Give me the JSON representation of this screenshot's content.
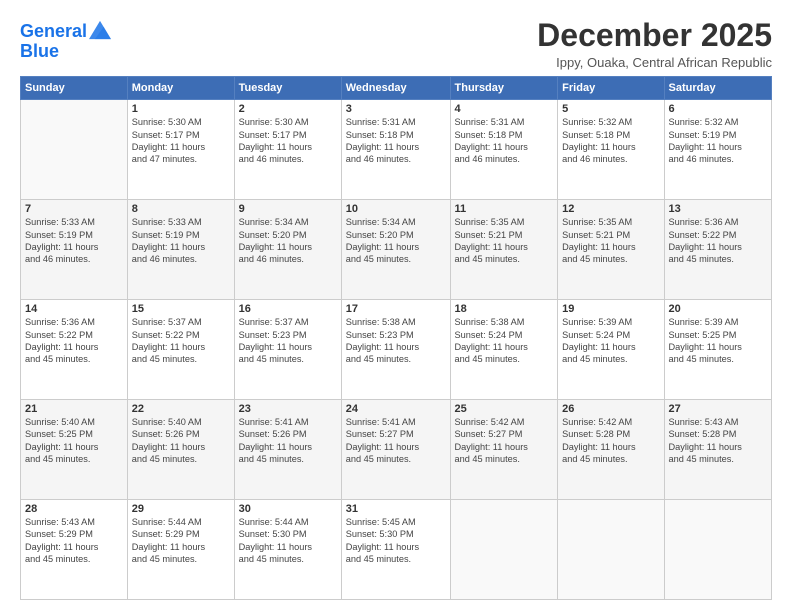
{
  "logo": {
    "line1": "General",
    "line2": "Blue"
  },
  "title": "December 2025",
  "subtitle": "Ippy, Ouaka, Central African Republic",
  "days_of_week": [
    "Sunday",
    "Monday",
    "Tuesday",
    "Wednesday",
    "Thursday",
    "Friday",
    "Saturday"
  ],
  "weeks": [
    [
      {
        "day": "",
        "info": ""
      },
      {
        "day": "1",
        "info": "Sunrise: 5:30 AM\nSunset: 5:17 PM\nDaylight: 11 hours\nand 47 minutes."
      },
      {
        "day": "2",
        "info": "Sunrise: 5:30 AM\nSunset: 5:17 PM\nDaylight: 11 hours\nand 46 minutes."
      },
      {
        "day": "3",
        "info": "Sunrise: 5:31 AM\nSunset: 5:18 PM\nDaylight: 11 hours\nand 46 minutes."
      },
      {
        "day": "4",
        "info": "Sunrise: 5:31 AM\nSunset: 5:18 PM\nDaylight: 11 hours\nand 46 minutes."
      },
      {
        "day": "5",
        "info": "Sunrise: 5:32 AM\nSunset: 5:18 PM\nDaylight: 11 hours\nand 46 minutes."
      },
      {
        "day": "6",
        "info": "Sunrise: 5:32 AM\nSunset: 5:19 PM\nDaylight: 11 hours\nand 46 minutes."
      }
    ],
    [
      {
        "day": "7",
        "info": "Sunrise: 5:33 AM\nSunset: 5:19 PM\nDaylight: 11 hours\nand 46 minutes."
      },
      {
        "day": "8",
        "info": "Sunrise: 5:33 AM\nSunset: 5:19 PM\nDaylight: 11 hours\nand 46 minutes."
      },
      {
        "day": "9",
        "info": "Sunrise: 5:34 AM\nSunset: 5:20 PM\nDaylight: 11 hours\nand 46 minutes."
      },
      {
        "day": "10",
        "info": "Sunrise: 5:34 AM\nSunset: 5:20 PM\nDaylight: 11 hours\nand 45 minutes."
      },
      {
        "day": "11",
        "info": "Sunrise: 5:35 AM\nSunset: 5:21 PM\nDaylight: 11 hours\nand 45 minutes."
      },
      {
        "day": "12",
        "info": "Sunrise: 5:35 AM\nSunset: 5:21 PM\nDaylight: 11 hours\nand 45 minutes."
      },
      {
        "day": "13",
        "info": "Sunrise: 5:36 AM\nSunset: 5:22 PM\nDaylight: 11 hours\nand 45 minutes."
      }
    ],
    [
      {
        "day": "14",
        "info": "Sunrise: 5:36 AM\nSunset: 5:22 PM\nDaylight: 11 hours\nand 45 minutes."
      },
      {
        "day": "15",
        "info": "Sunrise: 5:37 AM\nSunset: 5:22 PM\nDaylight: 11 hours\nand 45 minutes."
      },
      {
        "day": "16",
        "info": "Sunrise: 5:37 AM\nSunset: 5:23 PM\nDaylight: 11 hours\nand 45 minutes."
      },
      {
        "day": "17",
        "info": "Sunrise: 5:38 AM\nSunset: 5:23 PM\nDaylight: 11 hours\nand 45 minutes."
      },
      {
        "day": "18",
        "info": "Sunrise: 5:38 AM\nSunset: 5:24 PM\nDaylight: 11 hours\nand 45 minutes."
      },
      {
        "day": "19",
        "info": "Sunrise: 5:39 AM\nSunset: 5:24 PM\nDaylight: 11 hours\nand 45 minutes."
      },
      {
        "day": "20",
        "info": "Sunrise: 5:39 AM\nSunset: 5:25 PM\nDaylight: 11 hours\nand 45 minutes."
      }
    ],
    [
      {
        "day": "21",
        "info": "Sunrise: 5:40 AM\nSunset: 5:25 PM\nDaylight: 11 hours\nand 45 minutes."
      },
      {
        "day": "22",
        "info": "Sunrise: 5:40 AM\nSunset: 5:26 PM\nDaylight: 11 hours\nand 45 minutes."
      },
      {
        "day": "23",
        "info": "Sunrise: 5:41 AM\nSunset: 5:26 PM\nDaylight: 11 hours\nand 45 minutes."
      },
      {
        "day": "24",
        "info": "Sunrise: 5:41 AM\nSunset: 5:27 PM\nDaylight: 11 hours\nand 45 minutes."
      },
      {
        "day": "25",
        "info": "Sunrise: 5:42 AM\nSunset: 5:27 PM\nDaylight: 11 hours\nand 45 minutes."
      },
      {
        "day": "26",
        "info": "Sunrise: 5:42 AM\nSunset: 5:28 PM\nDaylight: 11 hours\nand 45 minutes."
      },
      {
        "day": "27",
        "info": "Sunrise: 5:43 AM\nSunset: 5:28 PM\nDaylight: 11 hours\nand 45 minutes."
      }
    ],
    [
      {
        "day": "28",
        "info": "Sunrise: 5:43 AM\nSunset: 5:29 PM\nDaylight: 11 hours\nand 45 minutes."
      },
      {
        "day": "29",
        "info": "Sunrise: 5:44 AM\nSunset: 5:29 PM\nDaylight: 11 hours\nand 45 minutes."
      },
      {
        "day": "30",
        "info": "Sunrise: 5:44 AM\nSunset: 5:30 PM\nDaylight: 11 hours\nand 45 minutes."
      },
      {
        "day": "31",
        "info": "Sunrise: 5:45 AM\nSunset: 5:30 PM\nDaylight: 11 hours\nand 45 minutes."
      },
      {
        "day": "",
        "info": ""
      },
      {
        "day": "",
        "info": ""
      },
      {
        "day": "",
        "info": ""
      }
    ]
  ]
}
